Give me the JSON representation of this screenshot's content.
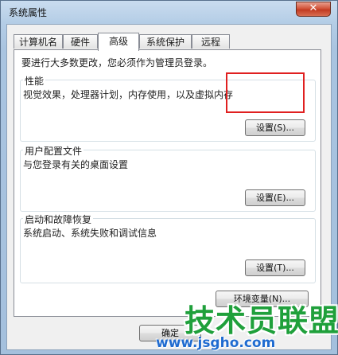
{
  "window": {
    "title": "系统属性",
    "close_glyph": "✕"
  },
  "tabs": [
    {
      "label": "计算机名"
    },
    {
      "label": "硬件"
    },
    {
      "label": "高级"
    },
    {
      "label": "系统保护"
    },
    {
      "label": "远程"
    }
  ],
  "advanced": {
    "intro": "要进行大多数更改，您必须作为管理员登录。",
    "performance": {
      "title": "性能",
      "desc": "视觉效果，处理器计划，内存使用，以及虚拟内存",
      "button": "设置(S)..."
    },
    "user_profiles": {
      "title": "用户配置文件",
      "desc": "与您登录有关的桌面设置",
      "button": "设置(E)..."
    },
    "startup_recovery": {
      "title": "启动和故障恢复",
      "desc": "系统启动、系统失败和调试信息",
      "button": "设置(T)..."
    },
    "env_button": "环境变量(N)..."
  },
  "footer": {
    "ok": "确定"
  },
  "watermark": {
    "main": "技术员联盟",
    "url": "www.jsgho.com"
  }
}
